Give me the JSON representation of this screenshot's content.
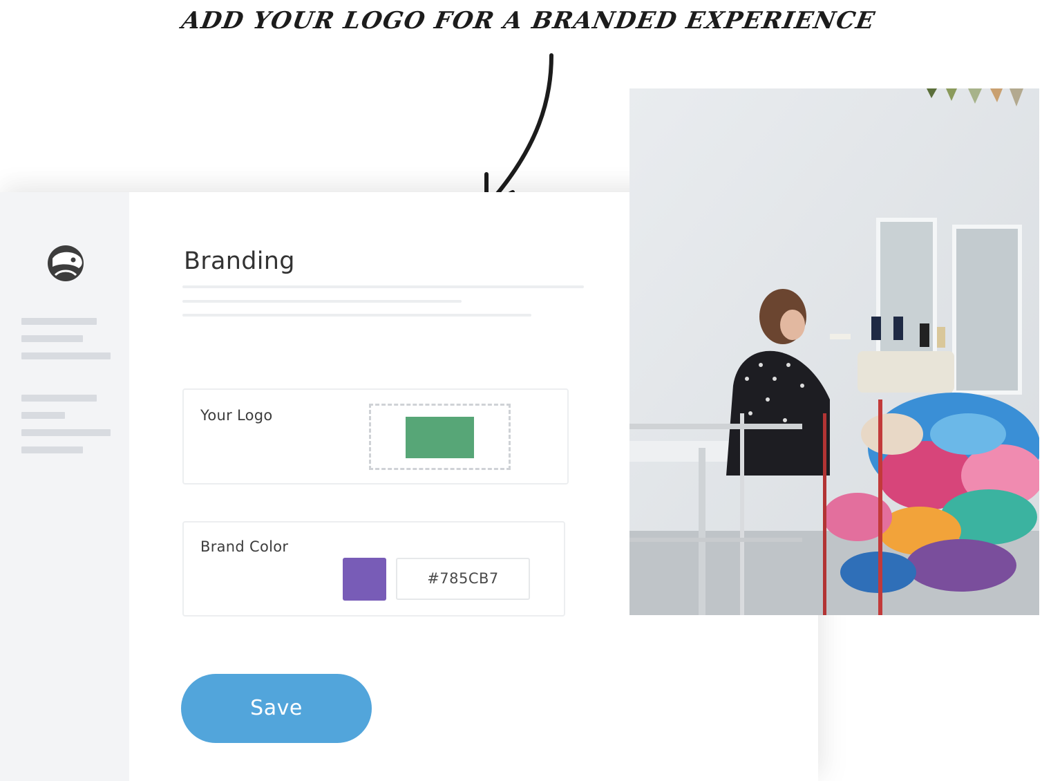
{
  "caption": "ADD YOUR LOGO FOR A BRANDED EXPERIENCE",
  "branding": {
    "title": "Branding",
    "logo_section": {
      "label": "Your Logo",
      "preview_color": "#57A677"
    },
    "color_section": {
      "label": "Brand Color",
      "value": "#785CB7",
      "swatch_color": "#785CB7"
    },
    "save_label": "Save"
  },
  "colors": {
    "accent": "#52A5DB",
    "sidebar_bg": "#F3F4F6"
  },
  "icons": {
    "app_logo": "beaver-logo-icon",
    "annotation_arrow": "curved-arrow-icon"
  }
}
